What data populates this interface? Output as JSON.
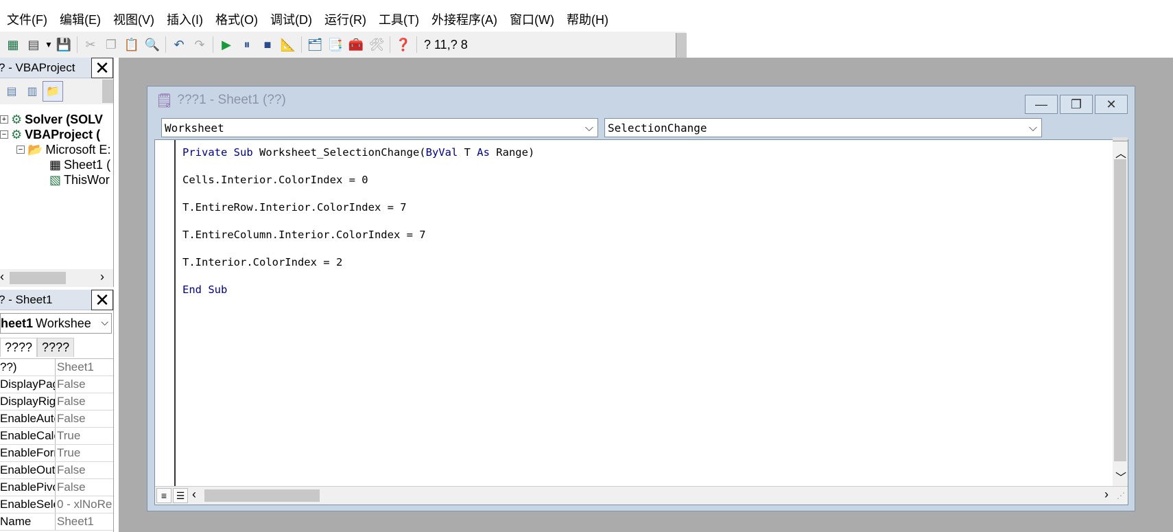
{
  "menu": [
    "文件(F)",
    "编辑(E)",
    "视图(V)",
    "插入(I)",
    "格式(O)",
    "调试(D)",
    "运行(R)",
    "工具(T)",
    "外接程序(A)",
    "窗口(W)",
    "帮助(H)"
  ],
  "toolbar": {
    "position": "? 11,? 8"
  },
  "project_pane": {
    "title": "? - VBAProject",
    "tree": [
      {
        "label": "Solver (SOLV",
        "bold": true
      },
      {
        "label": "VBAProject (",
        "bold": true
      },
      {
        "label": "Microsoft E:",
        "bold": false
      },
      {
        "label": "Sheet1 (",
        "bold": false
      },
      {
        "label": "ThisWor",
        "bold": false
      }
    ]
  },
  "props_pane": {
    "title": "? - Sheet1",
    "object": {
      "name": "heet1",
      "type": "Workshee"
    },
    "tabs": [
      "????",
      "????"
    ],
    "rows": [
      {
        "name": "??)",
        "value": "Sheet1"
      },
      {
        "name": "DisplayPag",
        "value": "False"
      },
      {
        "name": "DisplayRigl",
        "value": "False"
      },
      {
        "name": "EnableAuto",
        "value": "False"
      },
      {
        "name": "EnableCalc",
        "value": "True"
      },
      {
        "name": "EnableForn",
        "value": "True"
      },
      {
        "name": "EnableOutl",
        "value": "False"
      },
      {
        "name": "EnablePivo",
        "value": "False"
      },
      {
        "name": "EnableSele",
        "value": "0 - xlNoRe"
      },
      {
        "name": "Name",
        "value": "Sheet1"
      }
    ]
  },
  "code_window": {
    "title": "???1 - Sheet1 (??)",
    "object_combo": "Worksheet",
    "procedure_combo": "SelectionChange",
    "lines": [
      {
        "kw1": "Private Sub ",
        "t1": "Worksheet_SelectionChange(",
        "kw2": "ByVal",
        "t2": " T ",
        "kw3": "As",
        "t3": " Range)"
      },
      {
        "t1": "Cells.Interior.ColorIndex = 0"
      },
      {
        "t1": "T.EntireRow.Interior.ColorIndex = 7"
      },
      {
        "t1": "T.EntireColumn.Interior.ColorIndex = 7"
      },
      {
        "t1": "T.Interior.ColorIndex = 2"
      },
      {
        "kw1": "End Sub"
      }
    ]
  },
  "colors": {
    "keyword": "#00007f",
    "workspace": "#ababab",
    "window_frame": "#c7d5e4"
  }
}
